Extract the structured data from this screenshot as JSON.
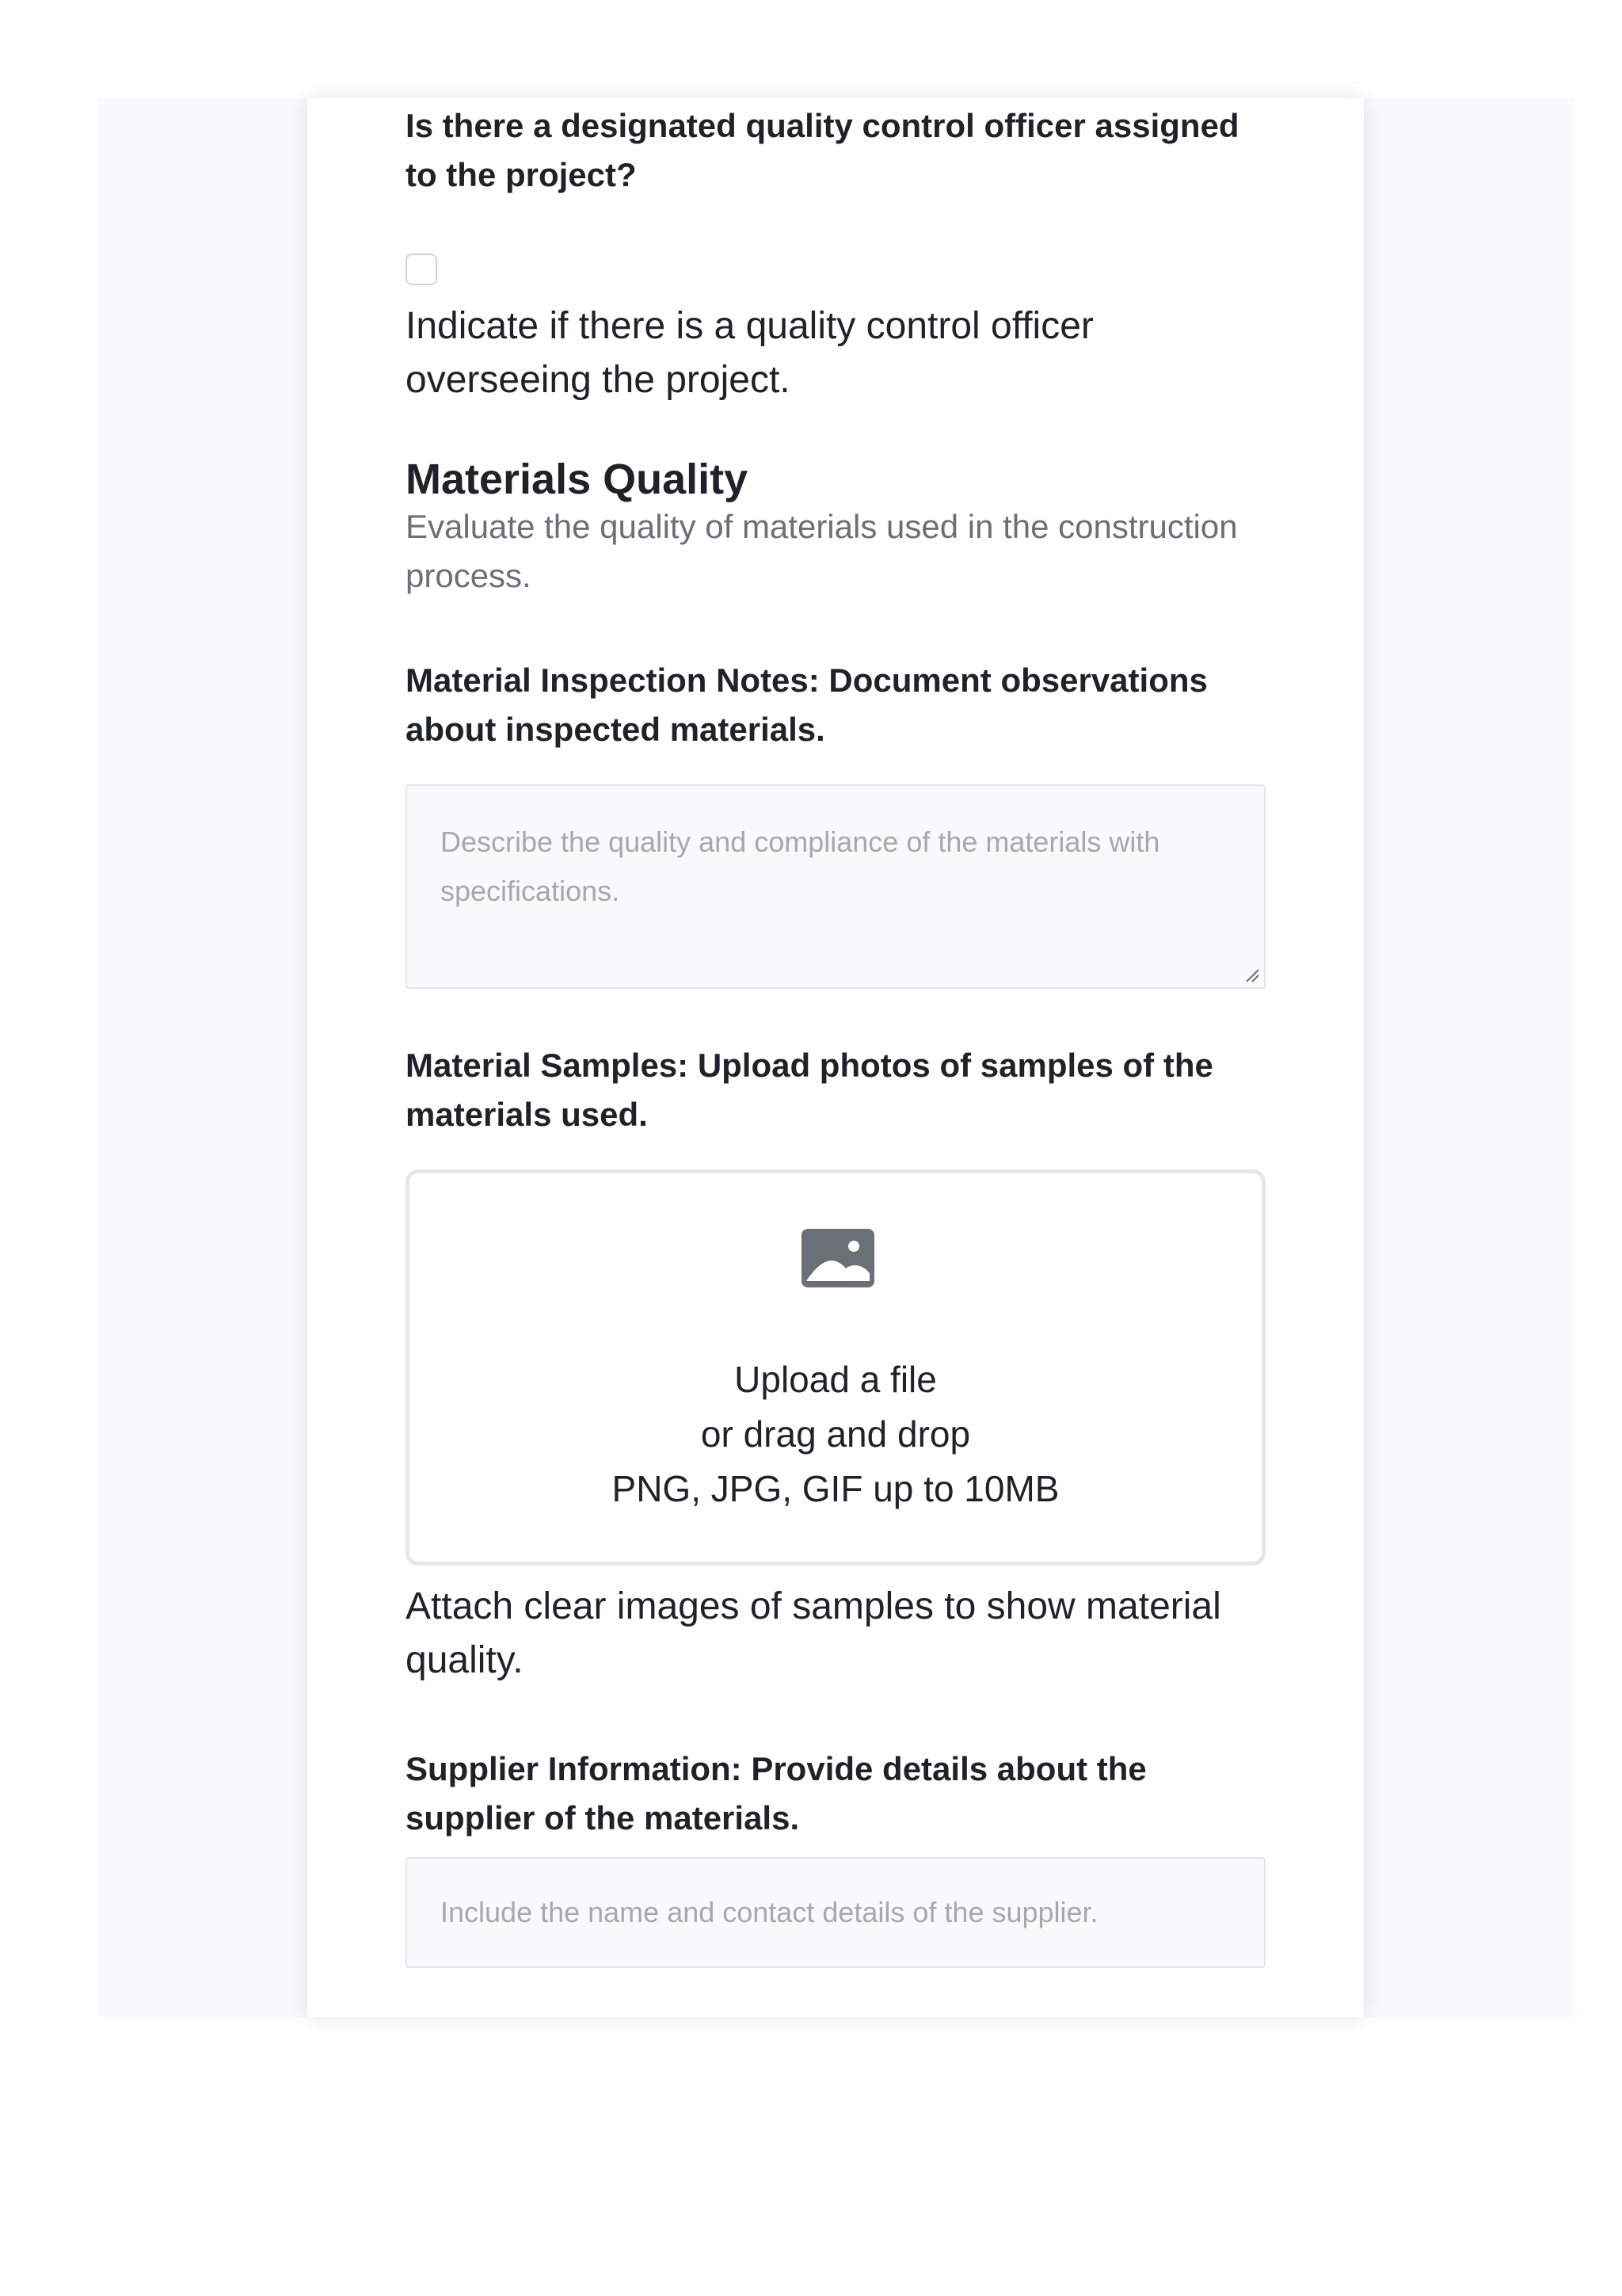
{
  "officer": {
    "question": "Is there a designated quality control officer assigned to the project?",
    "help": "Indicate if there is a quality control officer overseeing the project.",
    "checked": false
  },
  "materials_section": {
    "title": "Materials Quality",
    "description": "Evaluate the quality of materials used in the construction process."
  },
  "inspection_notes": {
    "label": "Material Inspection Notes: Document observations about inspected materials.",
    "placeholder": "Describe the quality and compliance of the materials with specifications."
  },
  "samples": {
    "label": "Material Samples: Upload photos of samples of the materials used.",
    "upload_link": "Upload a file",
    "drag_text": "or drag and drop",
    "file_types": "PNG, JPG, GIF up to 10MB",
    "help": "Attach clear images of samples to show material quality.",
    "icon": "image-icon"
  },
  "supplier": {
    "label": "Supplier Information: Provide details about the supplier of the materials.",
    "placeholder": "Include the name and contact details of the supplier."
  },
  "colors": {
    "text": "#1f2328",
    "muted": "#6b7078",
    "placeholder": "#a4a9b0",
    "border": "#e3e6ea",
    "field_bg": "#f8f9fb",
    "icon": "#6b7078"
  }
}
